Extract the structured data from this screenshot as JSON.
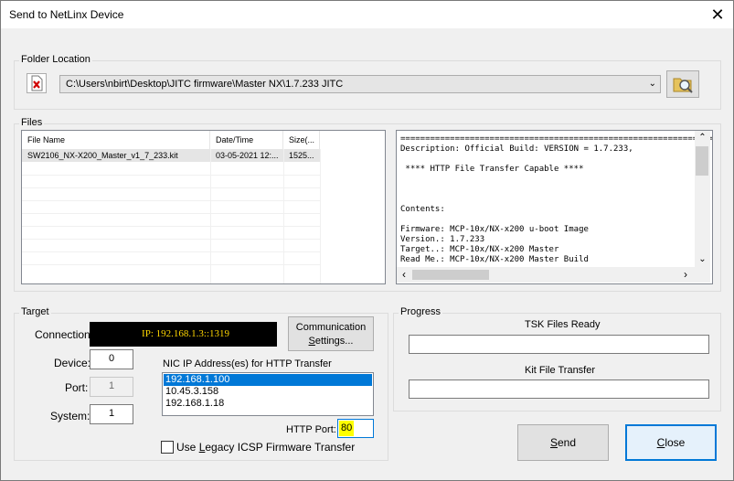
{
  "window": {
    "title": "Send to NetLinx Device",
    "close_glyph": "✕"
  },
  "folder": {
    "legend": "Folder Location",
    "path": "C:\\Users\\nbirt\\Desktop\\JITC firmware\\Master NX\\1.7.233 JITC"
  },
  "files": {
    "legend": "Files",
    "columns": [
      "File Name",
      "Date/Time",
      "Size(..."
    ],
    "rows": [
      {
        "name": "SW2106_NX-X200_Master_v1_7_233.kit",
        "date": "03-05-2021  12:...",
        "size": "1525..."
      }
    ],
    "description_lines": [
      "=================================================================",
      "Description: Official Build: VERSION = 1.7.233,",
      "",
      " **** HTTP File Transfer Capable ****",
      "",
      "",
      "",
      "Contents:",
      "",
      "Firmware: MCP-10x/NX-x200 u-boot Image",
      "Version.: 1.7.233",
      "Target..: MCP-10x/NX-x200 Master",
      "Read Me.: MCP-10x/NX-x200 Master Build"
    ]
  },
  "target": {
    "legend": "Target",
    "connection_label": "Connection:",
    "connection_value": "IP: 192.168.1.3::1319",
    "comm_settings_line1": "Communication",
    "comm_settings_line2_pre": "",
    "comm_settings_line2_u": "S",
    "comm_settings_line2_post": "ettings...",
    "device_label": "Device:",
    "device_value": "0",
    "port_label": "Port:",
    "port_value": "1",
    "system_label": "System:",
    "system_value": "1",
    "nic_label": "NIC IP Address(es) for HTTP Transfer",
    "nic_list": [
      "192.168.1.100",
      "10.45.3.158",
      "192.168.1.18"
    ],
    "nic_selected_index": 0,
    "http_port_label": "HTTP Port:",
    "http_port_value": "80",
    "legacy_pre": "Use ",
    "legacy_u": "L",
    "legacy_post": "egacy ICSP Firmware Transfer",
    "legacy_checked": false
  },
  "progress": {
    "legend": "Progress",
    "tsk_label": "TSK Files Ready",
    "kit_label": "Kit File Transfer",
    "tsk_value": 0,
    "kit_value": 0
  },
  "buttons": {
    "send_u": "S",
    "send_rest": "end",
    "close_u": "C",
    "close_rest": "lose"
  },
  "colors": {
    "highlight": "#0078d7",
    "port_highlight": "#ffff00",
    "connection_bg": "#000000",
    "connection_fg": "#ffd700",
    "close_border": "#0078d7",
    "close_bg": "#e5f1fb"
  }
}
